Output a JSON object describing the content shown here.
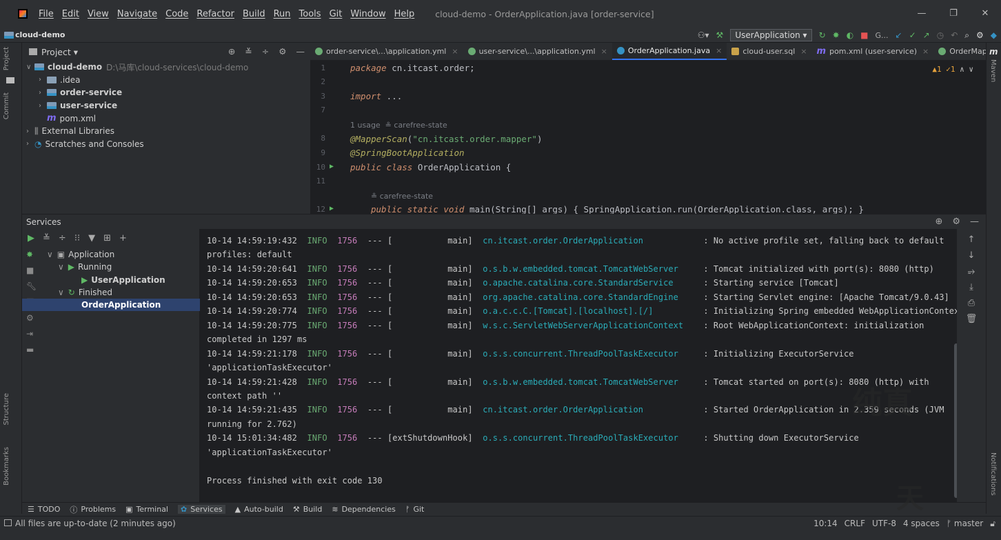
{
  "menubar": {
    "items": [
      "File",
      "Edit",
      "View",
      "Navigate",
      "Code",
      "Refactor",
      "Build",
      "Run",
      "Tools",
      "Git",
      "Window",
      "Help"
    ],
    "title": "cloud-demo - OrderApplication.java [order-service]",
    "minimize": "—",
    "maximize": "❐",
    "close": "✕"
  },
  "navbar": {
    "project": "cloud-demo",
    "run_config": "UserApplication",
    "git_label": "G..."
  },
  "left_strip": {
    "project": "Project",
    "commit": "Commit",
    "structure": "Structure",
    "bookmarks": "Bookmarks"
  },
  "right_strip": {
    "maven": "Maven",
    "notifications": "Notifications"
  },
  "project_panel": {
    "title": "Project",
    "tree": [
      {
        "label": "cloud-demo",
        "path": "D:\\马库\\cloud-services\\cloud-demo"
      },
      {
        "label": ".idea"
      },
      {
        "label": "order-service"
      },
      {
        "label": "user-service"
      },
      {
        "label": "pom.xml"
      },
      {
        "label": "External Libraries"
      },
      {
        "label": "Scratches and Consoles"
      }
    ]
  },
  "editor": {
    "tabs": [
      {
        "label": "order-service\\...\\application.yml",
        "color": "#6aab73"
      },
      {
        "label": "user-service\\...\\application.yml",
        "color": "#6aab73"
      },
      {
        "label": "OrderApplication.java",
        "color": "#3592c4"
      },
      {
        "label": "cloud-user.sql",
        "color": "#c9a24a"
      },
      {
        "label": "pom.xml (user-service)",
        "color": "#7f6cf2"
      },
      {
        "label": "OrderMapper.java",
        "color": "#6aab73"
      }
    ],
    "inspection": "▲1 ✓1",
    "line_numbers": [
      "1",
      "2",
      "3",
      "7",
      "8",
      "9",
      "10",
      "11",
      "12"
    ],
    "code": {
      "package_kw": "package",
      "package_name": " cn.itcast.order;",
      "import_kw": "import",
      "import_rest": " ...",
      "usage_hint": "1 usage  ≗ carefree-state",
      "mapper_ann": "@MapperScan",
      "mapper_arg": "\"cn.itcast.order.mapper\"",
      "boot_ann": "@SpringBootApplication",
      "class_kw": "public class",
      "class_name": " OrderApplication {",
      "author_hint": "≗ carefree-state",
      "main_kw": "public static void",
      "main_rest": " main(String[] args) { SpringApplication.run(OrderApplication.class, args); }"
    }
  },
  "services": {
    "title": "Services",
    "tree": {
      "application": "Application",
      "running": "Running",
      "user_app": "UserApplication",
      "finished": "Finished",
      "order_app": "OrderApplication"
    },
    "console": [
      {
        "ts": "10-14 14:59:19:432",
        "level": "INFO",
        "pid": "1756",
        "thread": "--- [           main]",
        "logger": "cn.itcast.order.OrderApplication          ",
        "msg": ": No active profile set, falling back to default"
      },
      {
        "cont": "profiles: default"
      },
      {
        "ts": "10-14 14:59:20:641",
        "level": "INFO",
        "pid": "1756",
        "thread": "--- [           main]",
        "logger": "o.s.b.w.embedded.tomcat.TomcatWebServer   ",
        "msg": ": Tomcat initialized with port(s): 8080 (http)"
      },
      {
        "ts": "10-14 14:59:20:653",
        "level": "INFO",
        "pid": "1756",
        "thread": "--- [           main]",
        "logger": "o.apache.catalina.core.StandardService    ",
        "msg": ": Starting service [Tomcat]"
      },
      {
        "ts": "10-14 14:59:20:653",
        "level": "INFO",
        "pid": "1756",
        "thread": "--- [           main]",
        "logger": "org.apache.catalina.core.StandardEngine   ",
        "msg": ": Starting Servlet engine: [Apache Tomcat/9.0.43]"
      },
      {
        "ts": "10-14 14:59:20:774",
        "level": "INFO",
        "pid": "1756",
        "thread": "--- [           main]",
        "logger": "o.a.c.c.C.[Tomcat].[localhost].[/]        ",
        "msg": ": Initializing Spring embedded WebApplicationContext"
      },
      {
        "ts": "10-14 14:59:20:775",
        "level": "INFO",
        "pid": "1756",
        "thread": "--- [           main]",
        "logger": "w.s.c.ServletWebServerApplicationContext  ",
        "msg": ": Root WebApplicationContext: initialization"
      },
      {
        "cont": "completed in 1297 ms"
      },
      {
        "ts": "10-14 14:59:21:178",
        "level": "INFO",
        "pid": "1756",
        "thread": "--- [           main]",
        "logger": "o.s.s.concurrent.ThreadPoolTaskExecutor   ",
        "msg": ": Initializing ExecutorService"
      },
      {
        "cont": "'applicationTaskExecutor'"
      },
      {
        "ts": "10-14 14:59:21:428",
        "level": "INFO",
        "pid": "1756",
        "thread": "--- [           main]",
        "logger": "o.s.b.w.embedded.tomcat.TomcatWebServer   ",
        "msg": ": Tomcat started on port(s): 8080 (http) with"
      },
      {
        "cont": "context path ''"
      },
      {
        "ts": "10-14 14:59:21:435",
        "level": "INFO",
        "pid": "1756",
        "thread": "--- [           main]",
        "logger": "cn.itcast.order.OrderApplication          ",
        "msg": ": Started OrderApplication in 2.359 seconds (JVM"
      },
      {
        "cont": "running for 2.762)"
      },
      {
        "ts": "10-14 15:01:34:482",
        "level": "INFO",
        "pid": "1756",
        "thread": "--- [extShutdownHook]",
        "logger": "o.s.s.concurrent.ThreadPoolTaskExecutor   ",
        "msg": ": Shutting down ExecutorService"
      },
      {
        "cont": "'applicationTaskExecutor'"
      },
      {
        "cont": ""
      },
      {
        "cont": "Process finished with exit code 130"
      }
    ]
  },
  "bottom_tools": [
    "TODO",
    "Problems",
    "Terminal",
    "Services",
    "Auto-build",
    "Build",
    "Dependencies",
    "Git"
  ],
  "status": {
    "message": "All files are up-to-date (2 minutes ago)",
    "position": "10:14",
    "line_sep": "CRLF",
    "encoding": "UTF-8",
    "indent": "4 spaces",
    "branch": "master"
  },
  "watermark": {
    "text1": "纯真",
    "text2": "天"
  }
}
